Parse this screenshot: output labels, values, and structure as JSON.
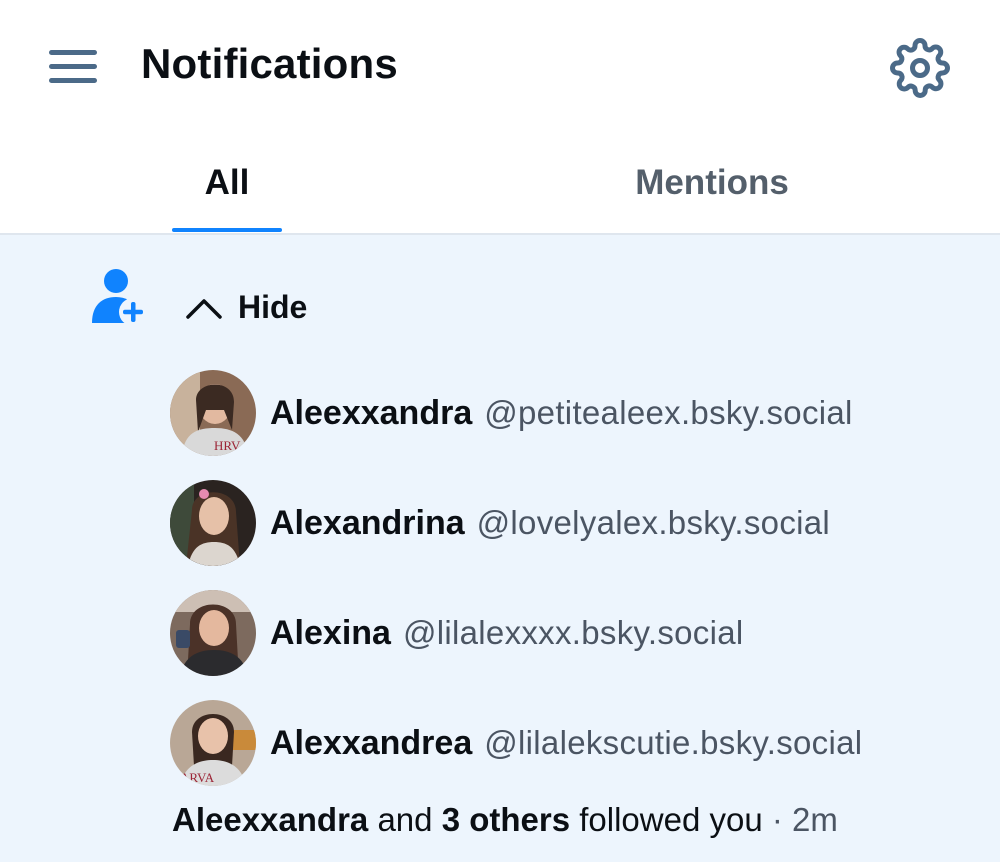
{
  "header": {
    "title": "Notifications",
    "menu_icon": "hamburger-menu-icon",
    "settings_icon": "gear-icon"
  },
  "tabs": [
    {
      "label": "All",
      "selected": true
    },
    {
      "label": "Mentions",
      "selected": false
    }
  ],
  "notification": {
    "type_icon": "person-add-icon",
    "toggle_label": "Hide",
    "toggle_icon": "chevron-up-icon",
    "users": [
      {
        "name": "Aleexxandra",
        "handle": "@petitealeex.bsky.social"
      },
      {
        "name": "Alexandrina",
        "handle": "@lovelyalex.bsky.social"
      },
      {
        "name": "Alexina",
        "handle": "@lilalexxxx.bsky.social"
      },
      {
        "name": "Alexxandrea",
        "handle": "@lilalekscutie.bsky.social"
      }
    ],
    "summary": {
      "first_name": "Aleexxandra",
      "and_text": "and",
      "others_text": "3 others",
      "action_text": "followed you",
      "separator": "·",
      "time": "2m"
    }
  },
  "colors": {
    "accent": "#1083fe",
    "icon": "#4b6a88",
    "unread_bg": "#edf5fd",
    "muted_text": "#4b5563"
  }
}
